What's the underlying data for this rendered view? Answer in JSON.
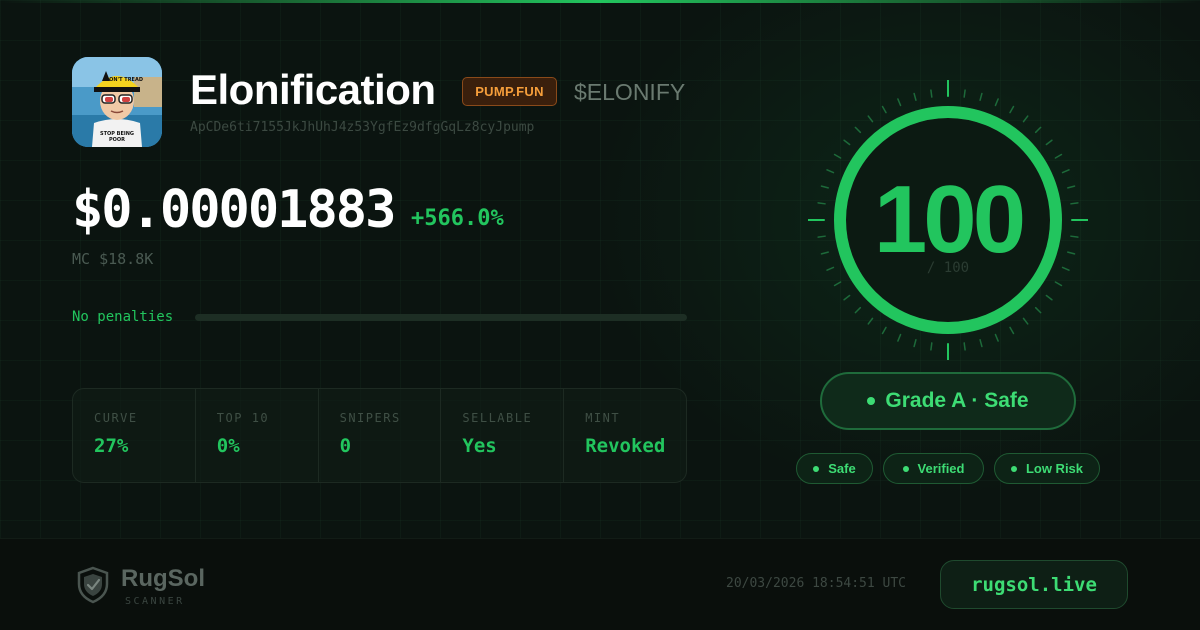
{
  "token": {
    "name": "Elonification",
    "platform": "PUMP.FUN",
    "ticker": "$ELONIFY",
    "address": "ApCDe6ti7155JkJhUhJ4z53YgfEz9dfgGqLz8cyJpump",
    "image_icon": "token-avatar-icon",
    "image_text": "DON'T TREAD ON ME / STOP BEING POOR"
  },
  "price": {
    "value": "$0.00001883",
    "change": "+566.0%",
    "market_cap": "MC $18.8K"
  },
  "penalties": {
    "label": "No penalties",
    "fill_fraction": 0
  },
  "stats": [
    {
      "label": "CURVE",
      "value": "27%"
    },
    {
      "label": "TOP 10",
      "value": "0%"
    },
    {
      "label": "SNIPERS",
      "value": "0"
    },
    {
      "label": "SELLABLE",
      "value": "Yes"
    },
    {
      "label": "MINT",
      "value": "Revoked"
    }
  ],
  "score": {
    "value": "100",
    "max": "/ 100",
    "fraction": 1.0
  },
  "grade": {
    "label": "Grade A · Safe"
  },
  "tags": [
    {
      "label": "Safe"
    },
    {
      "label": "Verified"
    },
    {
      "label": "Low Risk"
    }
  ],
  "footer": {
    "brand": "RugSol",
    "brand_sub": "SCANNER",
    "brand_icon": "shield-check-icon",
    "timestamp": "20/03/2026 18:54:51 UTC",
    "site": "rugsol.live"
  },
  "colors": {
    "accent": "#22c55e",
    "background": "#0b1410",
    "platform_badge": "#f59e3b"
  }
}
